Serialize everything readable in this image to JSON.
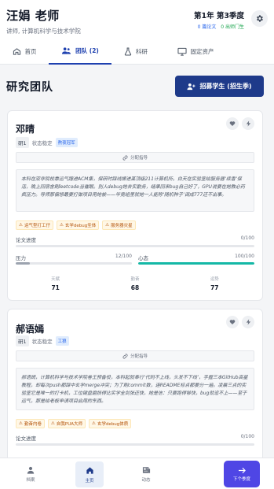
{
  "header": {
    "name": "汪娟 老师",
    "subtitle": "讲师, 计算机科学与技术学院",
    "term": "第1年 第3季度",
    "papers": "0 篇论文",
    "graduates": "0 出师门生"
  },
  "tabs": [
    {
      "label": "首页"
    },
    {
      "label": "团队 (2)"
    },
    {
      "label": "科研"
    },
    {
      "label": "固定资产"
    }
  ],
  "section": {
    "title": "研究团队",
    "recruit_label": "招募学生 (招生季)"
  },
  "students": [
    {
      "name": "邓晴",
      "grade": "研1",
      "state_label": "状态稳定",
      "tag": "熬夜冠军",
      "assign_label": "分配指导",
      "bio": "本科在双非院校靠运气蹭进ACM集，保研时踩线擦进某顶级211计算机所。白天在实验室给服务器‘续香’保活，晚上回宿舍刷leetcode当催眠。别人debug她去实勤务，结果回来bug自己好了，GPU说要在她教必药疯压力。导师那偏想最要打做项目用她被——毕竟组里就她一人能称‘随机种子’调成777还不出事。",
      "traits": [
        "运气型打工仔",
        "玄学debug圣体",
        "服务器灾星"
      ],
      "paper_label": "论文进度",
      "paper_value": "0/100",
      "paper_progress": 0,
      "pressure_label": "压力",
      "pressure_value": "12/100",
      "pressure_progress": 0.12,
      "mood_label": "心态",
      "mood_value": "100/100",
      "mood_progress": 1.0,
      "stats": [
        {
          "label": "天赋",
          "value": "71"
        },
        {
          "label": "勤奋",
          "value": "68"
        },
        {
          "label": "运势",
          "value": "77"
        }
      ]
    },
    {
      "name": "郝语嫣",
      "grade": "研1",
      "state_label": "状态稳定",
      "tag": "工狼",
      "assign_label": "分配指导",
      "bio": "郝语嫣，计算机科学与技术学院卷王预备役，本科起就奉行‘代码不上线，头发不下线’，手握三本GitHub高星教程，却每次push都踩中玄学merge冲突；为了刷commit数，连README标点都要分一遍。凌晨三点的实验室它是唯一的打卡机，工位键盘磨损得比实学全剑张还快，她是信：只要跑得够快，bug就追不上——至于运气，那是给老板申请项目启用的东西。",
      "traits": [
        "勤奋内卷",
        "自我PUA大师",
        "玄学debug体质"
      ],
      "paper_label": "论文进度",
      "paper_value": "0/100"
    }
  ],
  "bottom_nav": {
    "items": [
      {
        "label": "档案"
      },
      {
        "label": "主页"
      },
      {
        "label": "动态"
      }
    ],
    "next_label": "下个季度"
  },
  "colors": {
    "primary": "#1e3a8a",
    "accent": "#4f46e5",
    "mood": "#14b8a6",
    "pressure": "#9ca3af"
  }
}
